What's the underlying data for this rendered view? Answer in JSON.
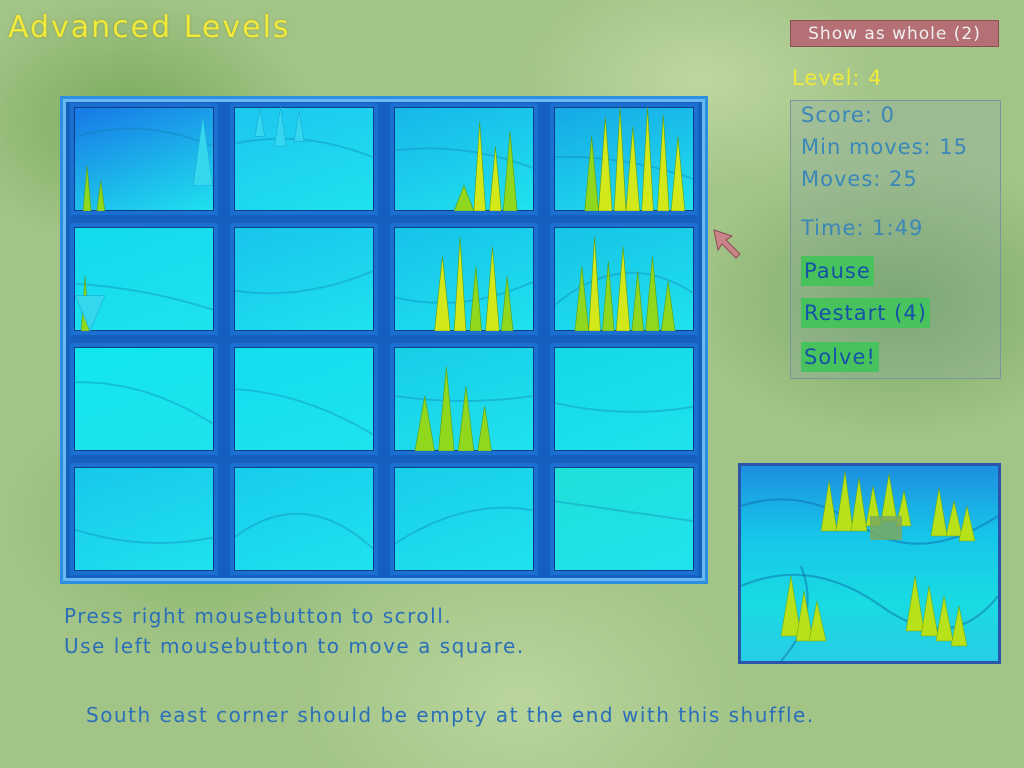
{
  "game": {
    "title": "Advanced Levels",
    "show_whole_label": "Show as whole (2)",
    "level_label": "Level: 4"
  },
  "stats": {
    "score": "Score: 0",
    "min_moves": "Min moves: 15",
    "moves": "Moves: 25",
    "time": "Time: 1:49"
  },
  "buttons": {
    "pause": "Pause",
    "restart": "Restart (4)",
    "solve": "Solve!"
  },
  "instructions": {
    "line1": "Press right mousebutton to scroll.",
    "line2": "Use left mousebutton to move a square."
  },
  "hint": "South east corner should be empty at the end with this shuffle.",
  "colors": {
    "title_yellow": "#f1ea3a",
    "stat_blue": "#3a87b8",
    "button_green": "#48c25c",
    "button_text": "#1552a8",
    "show_whole_bg": "#b57076",
    "board_frame": "#1b6fd0"
  },
  "board": {
    "rows": 4,
    "cols": 4,
    "tiles": [
      {
        "row": 0,
        "col": 0,
        "base": "#1877e6",
        "peaks": "left-edge"
      },
      {
        "row": 0,
        "col": 1,
        "base": "#1cc6ef",
        "peaks": "small-top"
      },
      {
        "row": 0,
        "col": 2,
        "base": "#17b6e9",
        "peaks": "tall-right"
      },
      {
        "row": 0,
        "col": 3,
        "base": "#16a7e6",
        "peaks": "dense-yellow"
      },
      {
        "row": 1,
        "col": 0,
        "base": "#12d9ed",
        "peaks": "left-small"
      },
      {
        "row": 1,
        "col": 1,
        "base": "#18c4ec",
        "peaks": "none"
      },
      {
        "row": 1,
        "col": 2,
        "base": "#16c2ea",
        "peaks": "tall-center"
      },
      {
        "row": 1,
        "col": 3,
        "base": "#17c3e6",
        "peaks": "dense-green"
      },
      {
        "row": 2,
        "col": 0,
        "base": "#10e6ee",
        "peaks": "none"
      },
      {
        "row": 2,
        "col": 1,
        "base": "#12ddef",
        "peaks": "none"
      },
      {
        "row": 2,
        "col": 2,
        "base": "#17cde8",
        "peaks": "base-green"
      },
      {
        "row": 2,
        "col": 3,
        "base": "#12d8e6",
        "peaks": "none"
      },
      {
        "row": 3,
        "col": 0,
        "base": "#17c7ea",
        "peaks": "none"
      },
      {
        "row": 3,
        "col": 1,
        "base": "#17ccec",
        "peaks": "none"
      },
      {
        "row": 3,
        "col": 2,
        "base": "#18cdea",
        "peaks": "none"
      },
      {
        "row": 3,
        "col": 3,
        "base": "#1fe0d8",
        "peaks": "none"
      }
    ]
  },
  "icons": {
    "cursor": "mouse-pointer-icon"
  }
}
